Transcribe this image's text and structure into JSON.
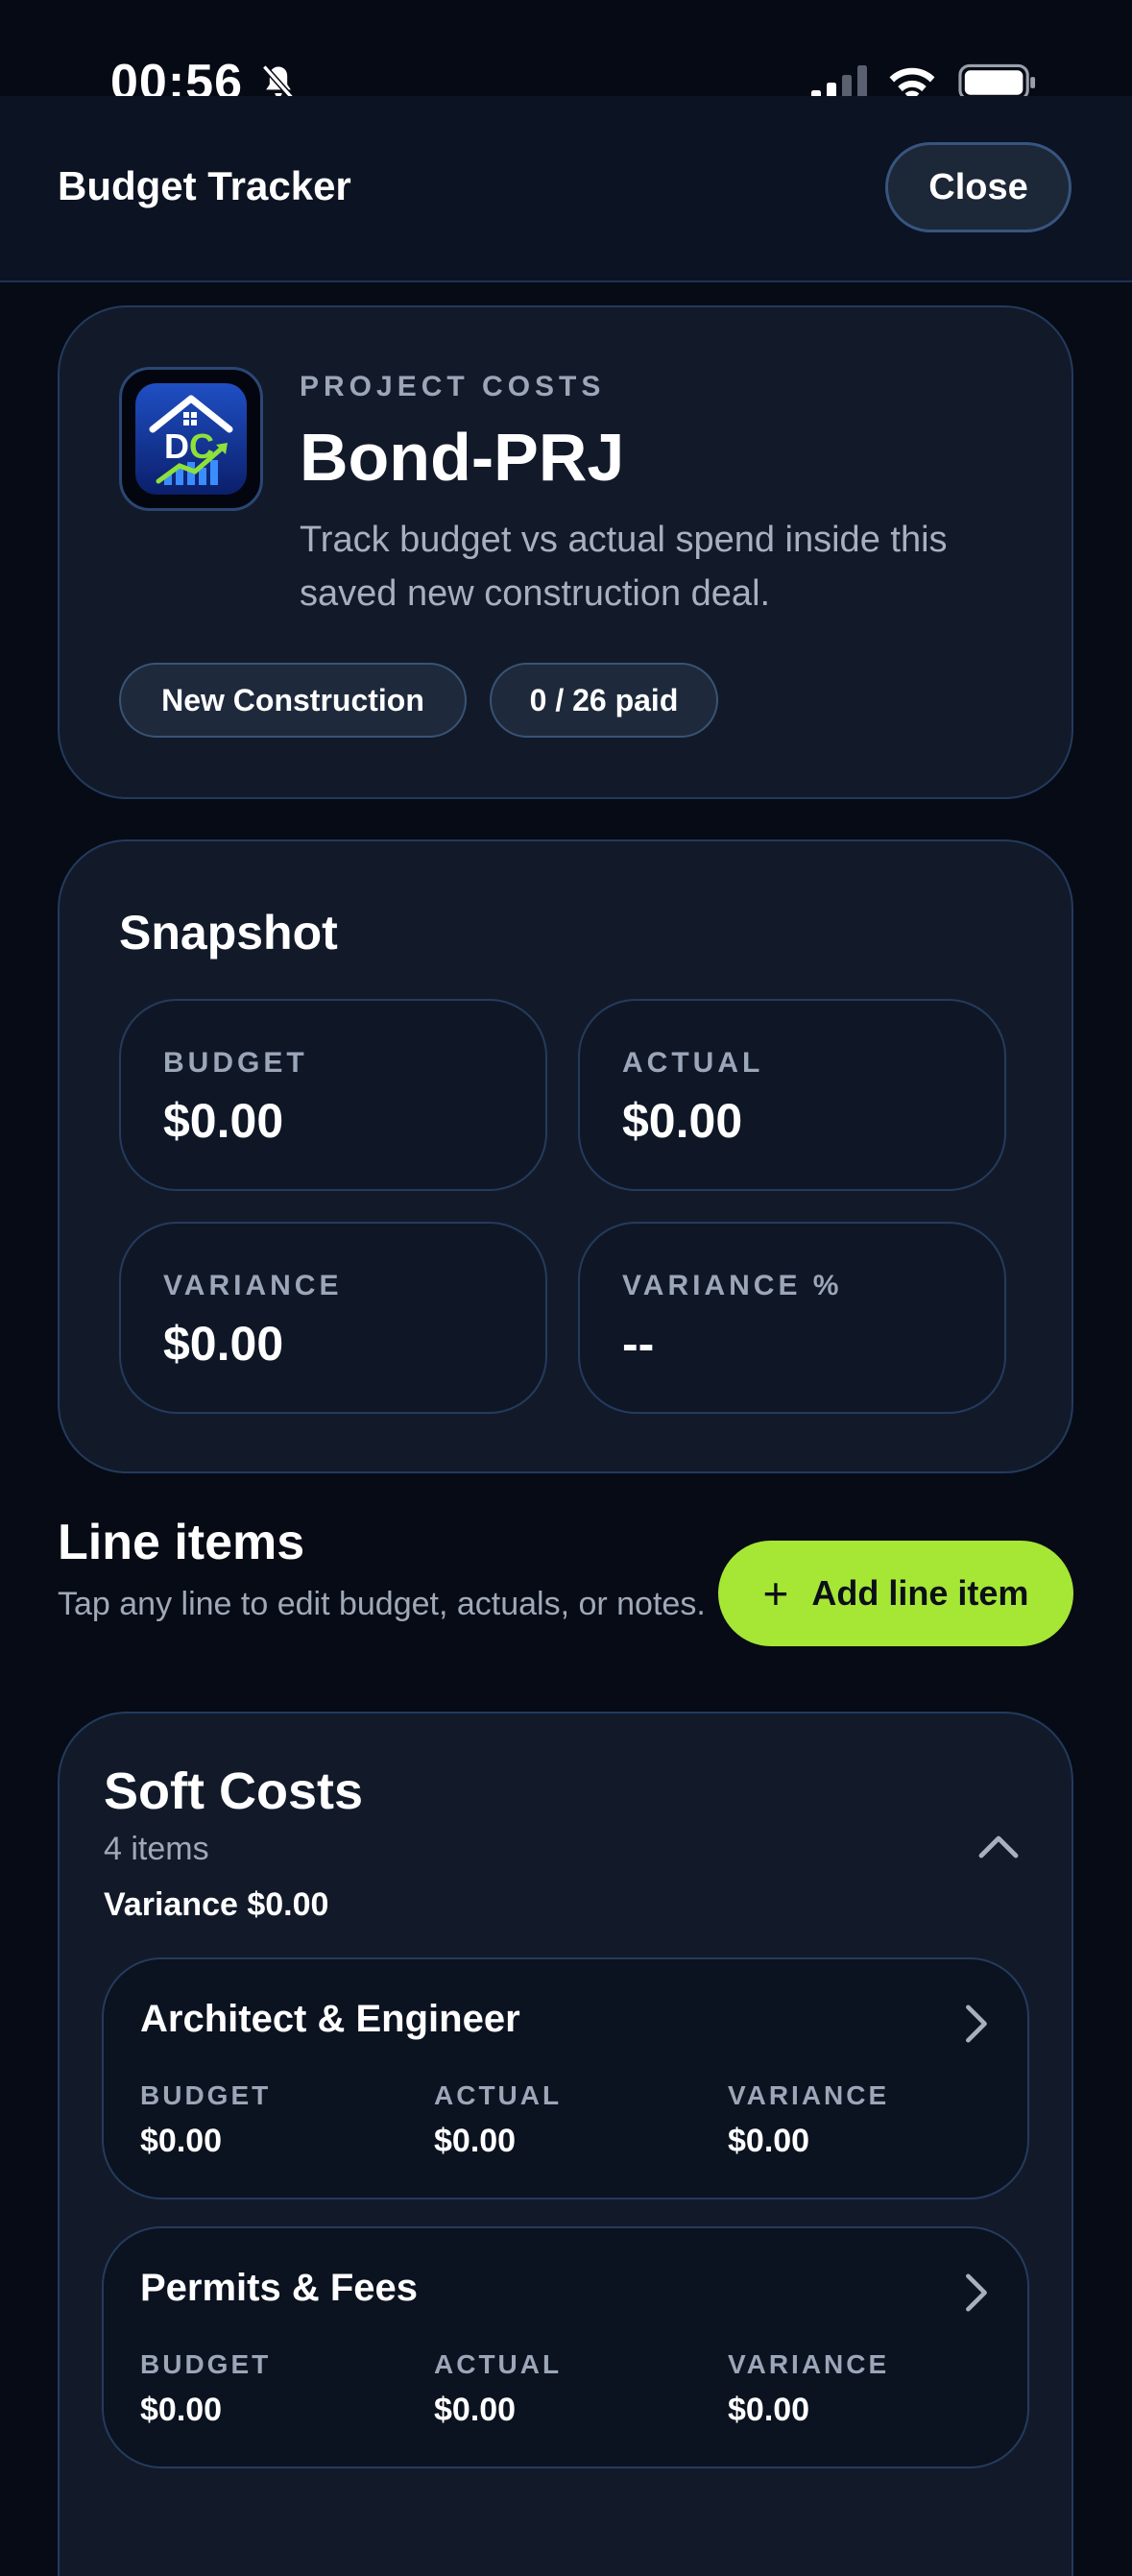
{
  "status_bar": {
    "time": "00:56"
  },
  "header": {
    "title": "Budget Tracker",
    "close_label": "Close"
  },
  "hero": {
    "eyebrow": "PROJECT COSTS",
    "project_name": "Bond-PRJ",
    "description": "Track budget vs actual spend inside this saved new construction deal.",
    "chips": [
      "New Construction",
      "0 / 26 paid"
    ],
    "logo_letters": "DC"
  },
  "snapshot": {
    "title": "Snapshot",
    "metrics": [
      {
        "label": "BUDGET",
        "value": "$0.00"
      },
      {
        "label": "ACTUAL",
        "value": "$0.00"
      },
      {
        "label": "VARIANCE",
        "value": "$0.00"
      },
      {
        "label": "VARIANCE %",
        "value": "--"
      }
    ]
  },
  "line_items": {
    "title": "Line items",
    "subtitle": "Tap any line to edit budget, actuals, or notes.",
    "add_label": "Add line item"
  },
  "groups": [
    {
      "title": "Soft Costs",
      "count": "4 items",
      "variance": "Variance $0.00",
      "items": [
        {
          "title": "Architect & Engineer",
          "budget_label": "BUDGET",
          "budget": "$0.00",
          "actual_label": "ACTUAL",
          "actual": "$0.00",
          "variance_label": "VARIANCE",
          "variance": "$0.00"
        },
        {
          "title": "Permits & Fees",
          "budget_label": "BUDGET",
          "budget": "$0.00",
          "actual_label": "ACTUAL",
          "actual": "$0.00",
          "variance_label": "VARIANCE",
          "variance": "$0.00"
        }
      ]
    }
  ],
  "colors": {
    "background": "#060b15",
    "card": "#121a2a",
    "border": "#233a5e",
    "accent_green": "#a6e635",
    "muted_text": "#9ba6b8"
  }
}
